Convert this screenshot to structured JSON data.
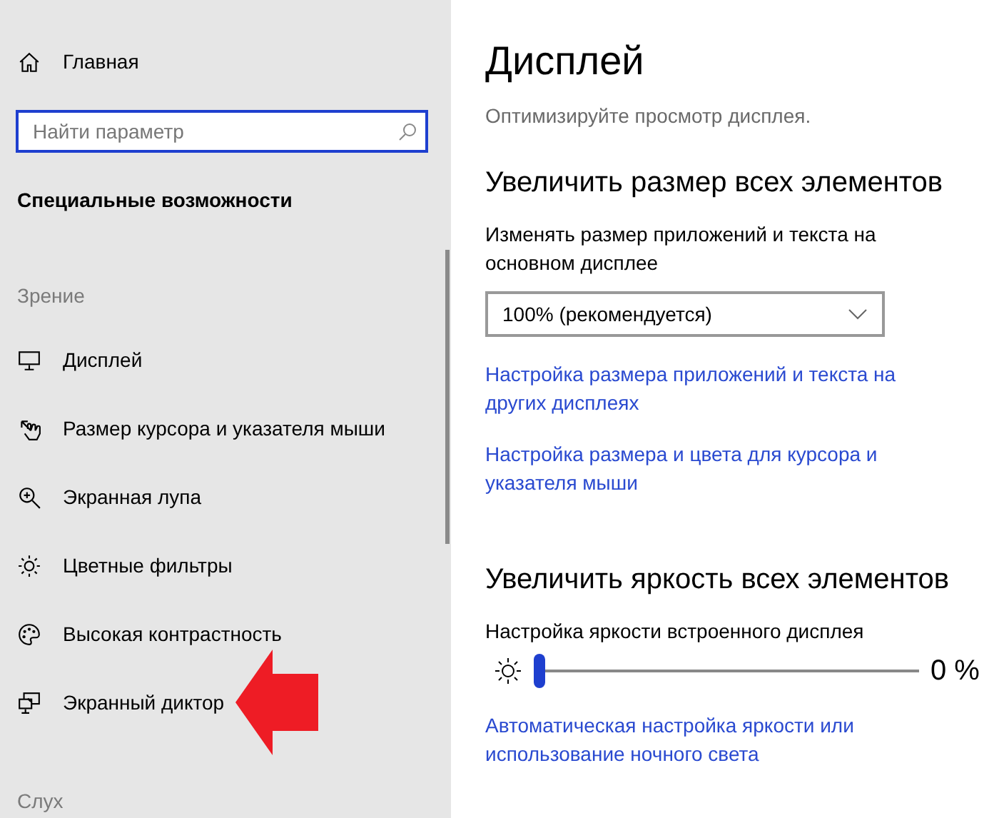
{
  "sidebar": {
    "home": {
      "label": "Главная"
    },
    "search": {
      "placeholder": "Найти параметр"
    },
    "title": "Специальные возможности",
    "sections": [
      {
        "heading": "Зрение",
        "items": [
          {
            "label": "Дисплей",
            "pointer": false
          },
          {
            "label": "Размер курсора и указателя мыши",
            "pointer": false
          },
          {
            "label": "Экранная лупа",
            "pointer": false
          },
          {
            "label": "Цветные фильтры",
            "pointer": false
          },
          {
            "label": "Высокая контрастность",
            "pointer": false
          },
          {
            "label": "Экранный диктор",
            "pointer": true
          }
        ]
      },
      {
        "heading": "Слух"
      }
    ]
  },
  "main": {
    "title": "Дисплей",
    "subtitle": "Оптимизируйте просмотр дисплея.",
    "groups": [
      {
        "heading": "Увеличить размер всех элементов",
        "blocks": [
          {
            "kind": "label",
            "text": "Изменять размер приложений и текста на основном дисплее"
          },
          {
            "kind": "dropdown",
            "value": "100% (рекомендуется)"
          },
          {
            "kind": "link",
            "text": "Настройка размера приложений и текста на других дисплеях"
          },
          {
            "kind": "link",
            "text": "Настройка размера и цвета для курсора и указателя мыши"
          }
        ]
      },
      {
        "heading": "Увеличить яркость всех элементов",
        "blocks": [
          {
            "kind": "label",
            "text": "Настройка яркости встроенного дисплея"
          },
          {
            "kind": "slider",
            "level": 0,
            "reading": "0 %"
          },
          {
            "kind": "link",
            "text": "Автоматическая настройка яркости или использование ночного света"
          }
        ]
      }
    ]
  }
}
